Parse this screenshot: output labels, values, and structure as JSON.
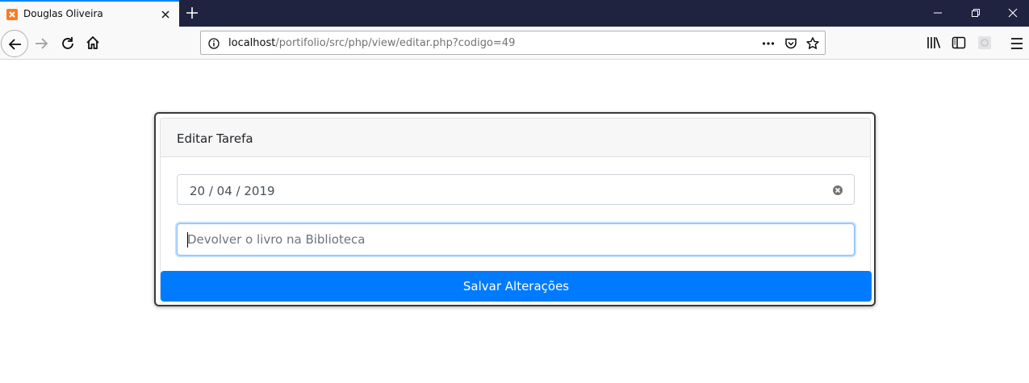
{
  "browser": {
    "tab": {
      "title": "Douglas Oliveira",
      "favicon": "xampp-icon"
    },
    "url": {
      "host": "localhost",
      "path": "/portifolio/src/php/view/editar.php?codigo=49"
    },
    "colors": {
      "tabbar": "#202340",
      "accent_tab": "#0a84ff",
      "toolbar": "#f9f9fa"
    }
  },
  "form": {
    "title": "Editar Tarefa",
    "date_value": "20 / 04 / 2019",
    "task_placeholder": "Devolver o livro na Biblioteca",
    "task_value": "",
    "submit_label": "Salvar Alterações",
    "colors": {
      "primary": "#007bff",
      "focus_border": "#80bdff"
    }
  }
}
